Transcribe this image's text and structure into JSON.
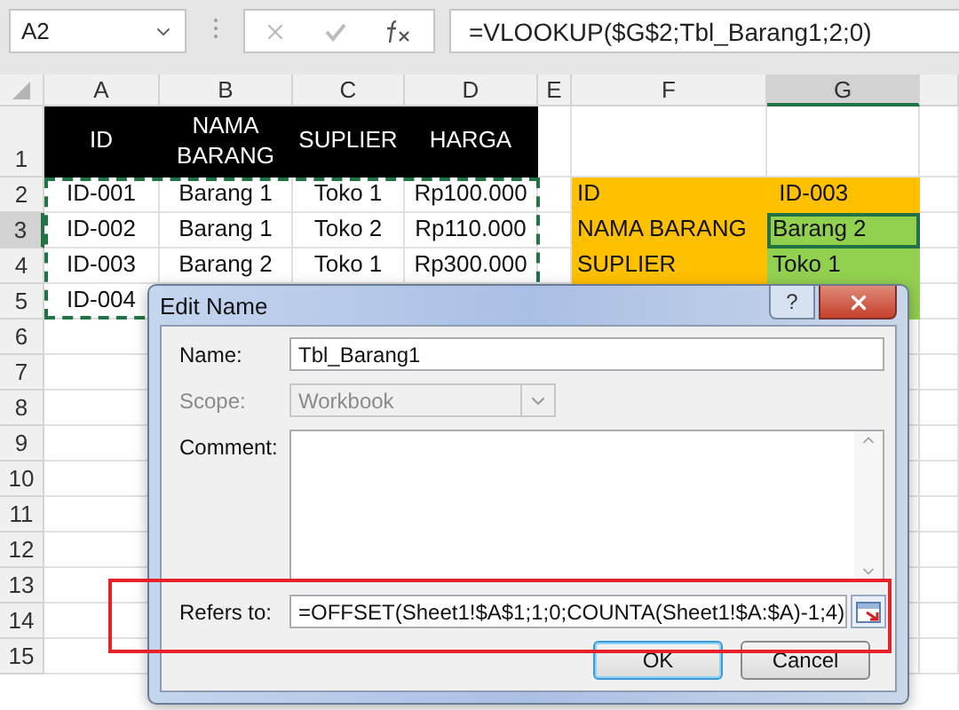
{
  "formula_bar": {
    "name_box": "A2",
    "formula": "=VLOOKUP($G$2;Tbl_Barang1;2;0)"
  },
  "sheet": {
    "columns": [
      "A",
      "B",
      "C",
      "D",
      "E",
      "F",
      "G"
    ],
    "copy_marquee": true,
    "rows": [
      {
        "number": "1",
        "cells": [
          {
            "kind": "header",
            "text": "ID",
            "selected": false
          },
          {
            "kind": "header",
            "text": "NAMA BARANG",
            "selected": false
          },
          {
            "kind": "header",
            "text": "SUPLIER",
            "selected": false
          },
          {
            "kind": "header",
            "text": "HARGA",
            "selected": false
          },
          {
            "kind": "blank"
          },
          {
            "kind": "blank"
          },
          {
            "kind": "blank"
          }
        ]
      },
      {
        "number": "2",
        "cells": [
          {
            "kind": "plain",
            "text": "ID-001",
            "selected": false
          },
          {
            "kind": "plain",
            "text": "Barang 1",
            "selected": false
          },
          {
            "kind": "plain",
            "text": "Toko 1",
            "selected": false
          },
          {
            "kind": "plain",
            "text": "Rp100.000",
            "selected": false
          },
          {
            "kind": "blank"
          },
          {
            "kind": "label",
            "text": "ID",
            "selected": false
          },
          {
            "kind": "label",
            "text": " ID-003",
            "selected": false
          }
        ]
      },
      {
        "number": "3",
        "cells": [
          {
            "kind": "plain",
            "text": "ID-002",
            "selected": false
          },
          {
            "kind": "plain",
            "text": "Barang 1",
            "selected": false
          },
          {
            "kind": "plain",
            "text": "Toko 2",
            "selected": false
          },
          {
            "kind": "plain",
            "text": "Rp110.000",
            "selected": false
          },
          {
            "kind": "blank"
          },
          {
            "kind": "label",
            "text": "NAMA BARANG",
            "selected": false
          },
          {
            "kind": "result",
            "text": "Barang 2",
            "selected": true
          }
        ]
      },
      {
        "number": "4",
        "cells": [
          {
            "kind": "plain",
            "text": "ID-003",
            "selected": false
          },
          {
            "kind": "plain",
            "text": "Barang 2",
            "selected": false
          },
          {
            "kind": "plain",
            "text": "Toko 1",
            "selected": false
          },
          {
            "kind": "plain",
            "text": "Rp300.000",
            "selected": false
          },
          {
            "kind": "blank"
          },
          {
            "kind": "label",
            "text": "SUPLIER",
            "selected": false
          },
          {
            "kind": "result",
            "text": "Toko 1",
            "selected": false
          }
        ]
      },
      {
        "number": "5",
        "cells": [
          {
            "kind": "plain",
            "text": "ID-004",
            "selected": false
          },
          {
            "kind": "blank"
          },
          {
            "kind": "blank"
          },
          {
            "kind": "blank"
          },
          {
            "kind": "blank"
          },
          {
            "kind": "label"
          },
          {
            "kind": "result"
          }
        ]
      },
      {
        "number": "6",
        "cells": []
      },
      {
        "number": "7",
        "cells": []
      },
      {
        "number": "8",
        "cells": []
      },
      {
        "number": "9",
        "cells": []
      },
      {
        "number": "10",
        "cells": []
      },
      {
        "number": "11",
        "cells": []
      },
      {
        "number": "12",
        "cells": []
      },
      {
        "number": "13",
        "cells": []
      },
      {
        "number": "14",
        "cells": []
      },
      {
        "number": "15",
        "cells": []
      }
    ]
  },
  "dialog": {
    "title": "Edit Name",
    "help": "?",
    "fields": [
      {
        "kind": "text",
        "label": "Name:",
        "value": "Tbl_Barang1",
        "disabled": false
      },
      {
        "kind": "dropdown",
        "label": "Scope:",
        "value": "Workbook",
        "disabled": true
      },
      {
        "kind": "textarea",
        "label": "Comment:",
        "disabled": false
      },
      {
        "kind": "reference",
        "label": "Refers to:",
        "value": "=OFFSET(Sheet1!$A$1;1;0;COUNTA(Sheet1!$A:$A)-1;4)",
        "disabled": false,
        "highlighted": true
      }
    ],
    "buttons": [
      {
        "label": "OK",
        "default": true
      },
      {
        "label": "Cancel",
        "default": false
      }
    ]
  }
}
